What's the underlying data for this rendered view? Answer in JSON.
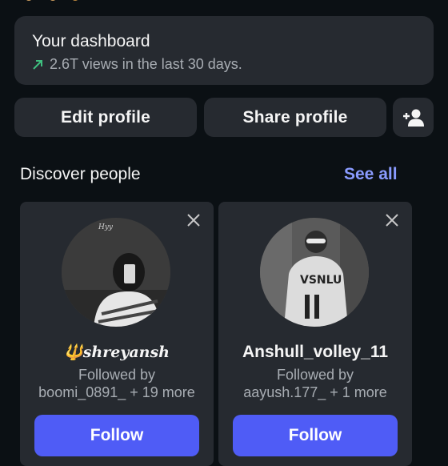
{
  "dashboard": {
    "title": "Your dashboard",
    "subtitle": "2.6T views in the last 30 days."
  },
  "profile_actions": {
    "edit_label": "Edit profile",
    "share_label": "Share profile",
    "add_user_icon": "person-add-icon"
  },
  "discover": {
    "title": "Discover people",
    "see_all_label": "See all",
    "cards": [
      {
        "name_prefix": "🔱",
        "name": "shreyansh",
        "followed_by": "Followed by",
        "followed_users": "boomi_0891_ + 19 more",
        "follow_label": "Follow",
        "avatar_caption": "Hyy"
      },
      {
        "name": "Anshull_volley_11",
        "followed_by": "Followed by",
        "followed_users": "aayush.177_ + 1 more",
        "follow_label": "Follow"
      }
    ]
  },
  "colors": {
    "background": "#0b1014",
    "card": "#262a30",
    "accent": "#4f5cf6",
    "link": "#8a9bff",
    "trend": "#3fbf7f"
  }
}
